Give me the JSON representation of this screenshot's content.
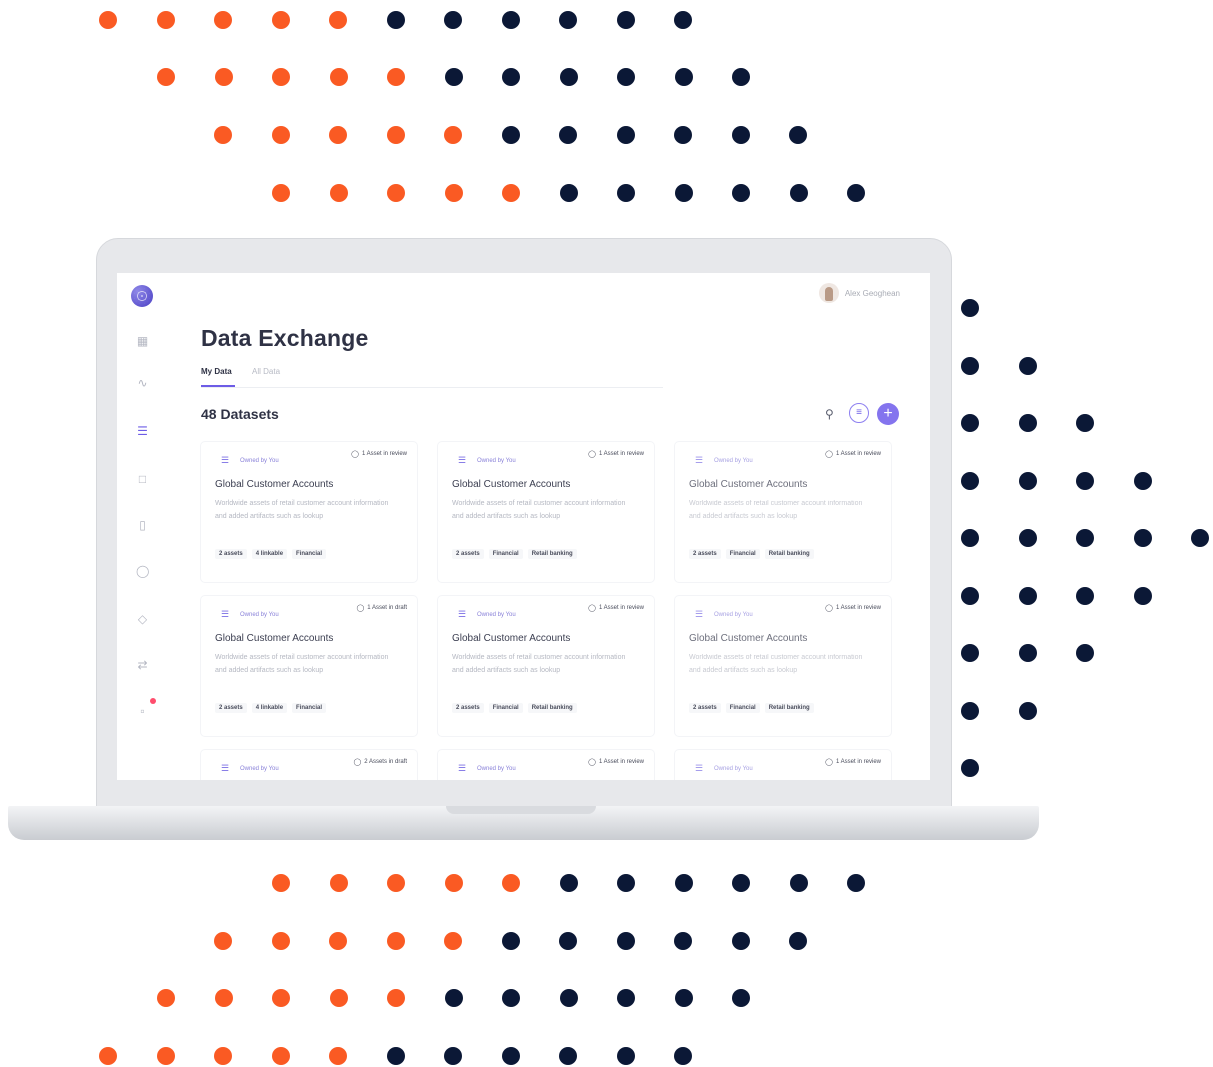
{
  "colors": {
    "accent_orange": "#fa5a23",
    "navy": "#0b1836",
    "brand_purple": "#6d5ce6"
  },
  "user": {
    "name": "Alex Geoghean"
  },
  "page": {
    "title": "Data Exchange",
    "count_label": "48 Datasets"
  },
  "tabs": [
    {
      "label": "My Data",
      "active": true
    },
    {
      "label": "All Data",
      "active": false
    }
  ],
  "sidebar": {
    "icons": [
      "grid-icon",
      "activity-icon",
      "database-icon",
      "folder-icon",
      "clipboard-icon",
      "shield-icon",
      "tag-icon",
      "transfer-icon",
      "chat-icon"
    ]
  },
  "toolbar": {
    "search_icon": "search-icon",
    "filter_icon": "filter-icon",
    "add_icon": "plus-icon"
  },
  "cards": [
    {
      "owner": "Owned by You",
      "status": "1 Asset in review",
      "title": "Global Customer Accounts",
      "desc": "Worldwide assets of retail customer account information and added artifacts such as lookup",
      "tags": [
        "2 assets",
        "4 linkable",
        "Financial"
      ]
    },
    {
      "owner": "Owned by You",
      "status": "1 Asset in review",
      "title": "Global Customer Accounts",
      "desc": "Worldwide assets of retail customer account information and added artifacts such as lookup",
      "tags": [
        "2 assets",
        "Financial",
        "Retail banking"
      ]
    },
    {
      "owner": "Owned by You",
      "status": "1 Asset in review",
      "title": "Global Customer Accounts",
      "desc": "Worldwide assets of retail customer account information and added artifacts such as lookup",
      "tags": [
        "2 assets",
        "Financial",
        "Retail banking"
      ]
    },
    {
      "owner": "Owned by You",
      "status": "1 Asset in draft",
      "title": "Global Customer Accounts",
      "desc": "Worldwide assets of retail customer account information and added artifacts such as lookup",
      "tags": [
        "2 assets",
        "4 linkable",
        "Financial"
      ]
    },
    {
      "owner": "Owned by You",
      "status": "1 Asset in review",
      "title": "Global Customer Accounts",
      "desc": "Worldwide assets of retail customer account information and added artifacts such as lookup",
      "tags": [
        "2 assets",
        "Financial",
        "Retail banking"
      ]
    },
    {
      "owner": "Owned by You",
      "status": "1 Asset in review",
      "title": "Global Customer Accounts",
      "desc": "Worldwide assets of retail customer account information and added artifacts such as lookup",
      "tags": [
        "2 assets",
        "Financial",
        "Retail banking"
      ]
    },
    {
      "owner": "Owned by You",
      "status": "2 Assets in draft"
    },
    {
      "owner": "Owned by You",
      "status": "1 Asset in review"
    },
    {
      "owner": "Owned by You",
      "status": "1 Asset in review"
    }
  ]
}
